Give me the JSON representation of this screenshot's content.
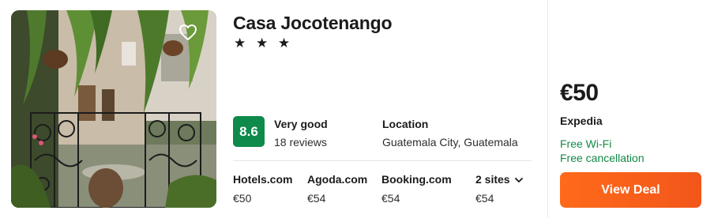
{
  "hotel": {
    "name": "Casa Jocotenango",
    "stars": "★ ★ ★"
  },
  "rating": {
    "score": "8.6",
    "label": "Very good",
    "reviews": "18 reviews",
    "badge_color": "#0e8a4a"
  },
  "location": {
    "title": "Location",
    "value": "Guatemala City, Guatemala"
  },
  "sites": [
    {
      "name": "Hotels.com",
      "price": "€50"
    },
    {
      "name": "Agoda.com",
      "price": "€54"
    },
    {
      "name": "Booking.com",
      "price": "€54"
    },
    {
      "name": "2 sites",
      "price": "€54"
    }
  ],
  "deal": {
    "price": "€50",
    "provider": "Expedia",
    "amenities": [
      "Free Wi-Fi",
      "Free cancellation"
    ],
    "button_label": "View Deal",
    "accent_color": "#ff6a1a",
    "amenity_color": "#118a46"
  },
  "icons": {
    "favorite": "heart-icon",
    "expand": "chevron-down-icon"
  }
}
